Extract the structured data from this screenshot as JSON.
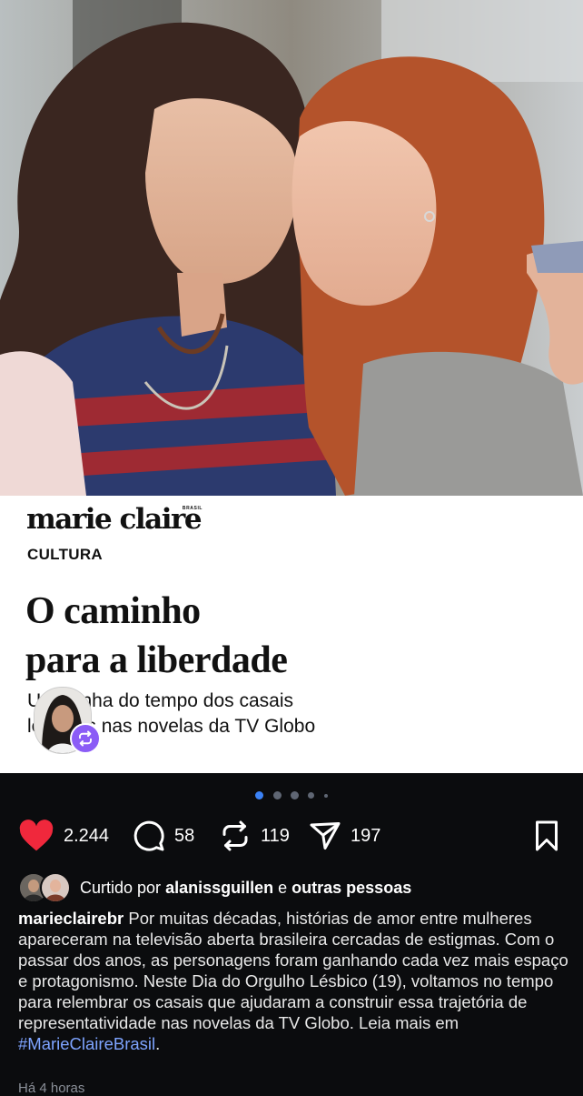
{
  "article": {
    "brand": "marie claire",
    "brand_sub": "BRASIL",
    "section": "CULTURA",
    "headline": [
      "O caminho",
      "para a liberdade"
    ],
    "subtitle": [
      "Uma linha do tempo dos casais",
      "lésbicos nas novelas da TV Globo"
    ]
  },
  "carousel": {
    "count": 5,
    "active": 0
  },
  "actions": {
    "likes": "2.244",
    "comments": "58",
    "reposts": "119",
    "shares": "197"
  },
  "liked_by": {
    "prefix": "Curtido por",
    "user": "alanissguillen",
    "connector": "e",
    "others": "outras pessoas"
  },
  "caption": {
    "username": "marieclairebr",
    "text": "Por muitas décadas, histórias de amor entre mulheres apareceram na televisão aberta brasileira cercadas de estigmas. Com o passar dos anos, as personagens foram ganhando cada vez mais espaço e protagonismo. Neste Dia do Orgulho Lésbico (19), voltamos no tempo para relembrar os casais que ajudaram a construir essa trajetória de representatividade nas novelas da TV Globo. Leia mais em",
    "hashtag": "#MarieClaireBrasil",
    "end": "."
  },
  "timestamp": "Há 4 horas",
  "colors": {
    "like": "#f0283c",
    "accent": "#8b5cf6",
    "hashtag": "#7ea4ff",
    "background": "#0b0c0e"
  }
}
